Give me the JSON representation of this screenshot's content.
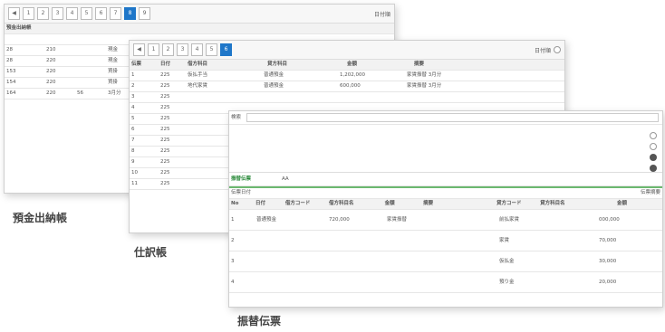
{
  "captions": {
    "deposit": "預金出納帳",
    "journal": "仕訳帳",
    "transfer": "振替伝票"
  },
  "w1": {
    "account_label": "預金出納帳",
    "top_right": "日付順",
    "rows": [
      {
        "a": "",
        "b": "",
        "c": "",
        "d": ""
      },
      {
        "a": "28",
        "b": "210",
        "c": "",
        "d": "現金"
      },
      {
        "a": "28",
        "b": "220",
        "c": "",
        "d": "現金"
      },
      {
        "a": "153",
        "b": "220",
        "c": "",
        "d": "買掛"
      },
      {
        "a": "154",
        "b": "220",
        "c": "",
        "d": "買掛"
      },
      {
        "a": "164",
        "b": "220",
        "c": "56",
        "d": "3月分"
      }
    ]
  },
  "w2": {
    "title_field": "日付順",
    "headers": [
      "伝票",
      "日付",
      "借方科目",
      "",
      "貸方科目",
      "",
      "金額",
      "摘要"
    ],
    "rows": [
      {
        "no": "1",
        "date": "225",
        "dr": "仮払手当",
        "cr": "普通預金",
        "amt": "1,202,000",
        "memo": "家賃振替 3月分"
      },
      {
        "no": "2",
        "date": "225",
        "dr": "地代家賃",
        "cr": "普通預金",
        "amt": "600,000",
        "memo": "家賃振替 3月分"
      },
      {
        "no": "3",
        "date": "225",
        "dr": "",
        "cr": "",
        "amt": "",
        "memo": ""
      },
      {
        "no": "4",
        "date": "225",
        "dr": "",
        "cr": "",
        "amt": "",
        "memo": ""
      },
      {
        "no": "5",
        "date": "225",
        "dr": "",
        "cr": "",
        "amt": "",
        "memo": ""
      },
      {
        "no": "6",
        "date": "225",
        "dr": "",
        "cr": "",
        "amt": "",
        "memo": ""
      },
      {
        "no": "7",
        "date": "225",
        "dr": "",
        "cr": "",
        "amt": "",
        "memo": ""
      },
      {
        "no": "8",
        "date": "225",
        "dr": "",
        "cr": "",
        "amt": "",
        "memo": ""
      },
      {
        "no": "9",
        "date": "225",
        "dr": "",
        "cr": "",
        "amt": "",
        "memo": ""
      },
      {
        "no": "10",
        "date": "225",
        "dr": "",
        "cr": "",
        "amt": "",
        "memo": ""
      },
      {
        "no": "11",
        "date": "225",
        "dr": "",
        "cr": "",
        "amt": "",
        "memo": ""
      }
    ]
  },
  "w3": {
    "section_title": "振替伝票",
    "field_aa": "AA",
    "subhdr_left": "伝票日付",
    "subhdr_right": "伝票摘要",
    "headers": [
      "No",
      "日付",
      "借方コード",
      "借方科目名",
      "金額",
      "摘要",
      "貸方コード",
      "貸方科目名",
      "",
      "金額"
    ],
    "rows": [
      {
        "no": "1",
        "dr": "普通預金",
        "amt": "720,000",
        "memo": "家賃振替",
        "cr": "前払家賃",
        "camt": "000,000"
      },
      {
        "no": "2",
        "dr": "",
        "amt": "",
        "memo": "",
        "cr": "家賃",
        "camt": "70,000"
      },
      {
        "no": "3",
        "dr": "",
        "amt": "",
        "memo": "",
        "cr": "仮払金",
        "camt": "30,000"
      },
      {
        "no": "4",
        "dr": "",
        "amt": "",
        "memo": "",
        "cr": "預り金",
        "camt": "20,000"
      }
    ]
  }
}
